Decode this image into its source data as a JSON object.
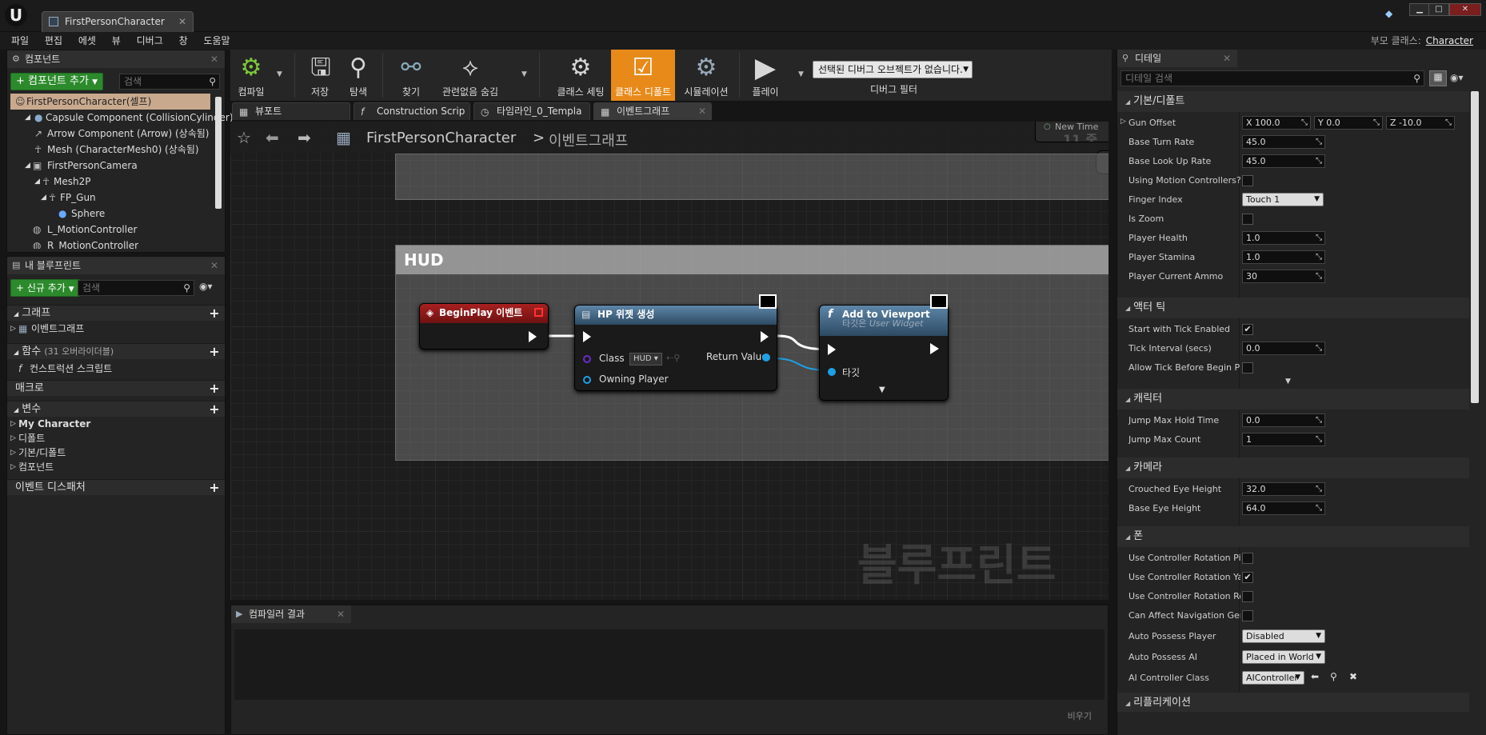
{
  "window": {
    "tab_title": "FirstPersonCharacter",
    "minimize": "▁",
    "maximize": "□",
    "close": "✕"
  },
  "menu": [
    "파일",
    "편집",
    "에셋",
    "뷰",
    "디버그",
    "창",
    "도움말"
  ],
  "parent_class": {
    "label": "부모 클래스:",
    "value": "Character"
  },
  "components": {
    "tab": "컴포넌트",
    "add_button": "컴포넌트 추가",
    "search_placeholder": "검색",
    "root": "FirstPersonCharacter(셀프)",
    "items": [
      "Capsule Component (CollisionCylinder)",
      "Arrow Component (Arrow) (상속됨)",
      "Mesh (CharacterMesh0) (상속됨)",
      "FirstPersonCamera",
      "Mesh2P",
      "FP_Gun",
      "Sphere",
      "L_MotionController",
      "R_MotionController"
    ]
  },
  "my_blueprint": {
    "tab": "내 블루프린트",
    "add_button": "신규 추가",
    "search_placeholder": "검색",
    "graphs_label": "그래프",
    "event_graph": "이벤트그래프",
    "functions_label": "함수",
    "functions_count": "(31 오버라이더블)",
    "construction_script": "컨스트럭션 스크립트",
    "macros_label": "매크로",
    "variables_label": "변수",
    "var_groups": [
      "My Character",
      "디폴트",
      "기본/디폴트",
      "컴포넌트"
    ],
    "dispatchers_label": "이벤트 디스패처"
  },
  "toolbar": {
    "compile": "컴파일",
    "save": "저장",
    "browse": "탐색",
    "find": "찾기",
    "hide_unrelated": "관련없음 숨김",
    "class_settings": "클래스 세팅",
    "class_defaults": "클래스 디폴트",
    "simulation": "시뮬레이션",
    "play": "플레이",
    "debug_select": "선택된 디버그 오브젝트가 없습니다.",
    "debug_filter": "디버그 필터"
  },
  "editor_tabs": [
    "뷰포트",
    "Construction Scrip",
    "타임라인_0_Templa",
    "이벤트그래프"
  ],
  "breadcrumb": {
    "root": "FirstPersonCharacter",
    "sep": ">",
    "current": "이벤트그래프"
  },
  "graph": {
    "partial_node_text": "New Time",
    "partial_node_number": "11.중",
    "comment_title": "HUD",
    "watermark": "블루프린트",
    "nodes": {
      "begin_play": "BeginPlay 이벤트",
      "create_widget": "HP 위젯 생성",
      "class_label": "Class",
      "class_value": "HUD",
      "owning_player": "Owning Player",
      "return_value": "Return Value",
      "add_to_viewport": "Add to Viewport",
      "target_subtitle_prefix": "타깃은",
      "target_subtitle_value": "User Widget",
      "target_pin": "타깃"
    },
    "colors": {
      "event_header": "#8e1a1a",
      "function_header": "#3a5f80",
      "object_pin": "#1ea0e6",
      "class_pin": "#6a2cc7"
    }
  },
  "compiler": {
    "tab": "컴파일러 결과",
    "clear": "비우기"
  },
  "details": {
    "tab": "디테일",
    "search_placeholder": "디테일 검색",
    "categories": {
      "defaults": "기본/디폴트",
      "actor_tick": "액터 틱",
      "character": "캐릭터",
      "camera": "카메라",
      "pawn": "폰",
      "replication": "리플리케이션"
    },
    "gun_offset": {
      "label": "Gun Offset",
      "x": "X  100.0",
      "y": "Y  0.0",
      "z": "Z  -10.0"
    },
    "base_turn_rate": {
      "label": "Base Turn Rate",
      "value": "45.0"
    },
    "base_look_up_rate": {
      "label": "Base Look Up Rate",
      "value": "45.0"
    },
    "using_motion_controllers": {
      "label": "Using Motion Controllers?",
      "checked": false
    },
    "finger_index": {
      "label": "Finger Index",
      "value": "Touch 1"
    },
    "is_zoom": {
      "label": "Is Zoom",
      "checked": false
    },
    "player_health": {
      "label": "Player Health",
      "value": "1.0"
    },
    "player_stamina": {
      "label": "Player Stamina",
      "value": "1.0"
    },
    "player_current_ammo": {
      "label": "Player Current Ammo",
      "value": "30"
    },
    "start_with_tick": {
      "label": "Start with Tick Enabled",
      "checked": true
    },
    "tick_interval": {
      "label": "Tick Interval (secs)",
      "value": "0.0"
    },
    "allow_tick_before_begin": {
      "label": "Allow Tick Before Begin Pla",
      "checked": false
    },
    "jump_max_hold": {
      "label": "Jump Max Hold Time",
      "value": "0.0"
    },
    "jump_max_count": {
      "label": "Jump Max Count",
      "value": "1"
    },
    "crouched_eye_height": {
      "label": "Crouched Eye Height",
      "value": "32.0"
    },
    "base_eye_height": {
      "label": "Base Eye Height",
      "value": "64.0"
    },
    "use_rot_pitch": {
      "label": "Use Controller Rotation Pitc",
      "checked": false
    },
    "use_rot_yaw": {
      "label": "Use Controller Rotation Yav",
      "checked": true
    },
    "use_rot_roll": {
      "label": "Use Controller Rotation Roll",
      "checked": false
    },
    "can_affect_nav": {
      "label": "Can Affect Navigation Gene",
      "checked": false
    },
    "auto_possess_player": {
      "label": "Auto Possess Player",
      "value": "Disabled"
    },
    "auto_possess_ai": {
      "label": "Auto Possess AI",
      "value": "Placed in World"
    },
    "ai_controller_class": {
      "label": "AI Controller Class",
      "value": "AIController"
    }
  }
}
